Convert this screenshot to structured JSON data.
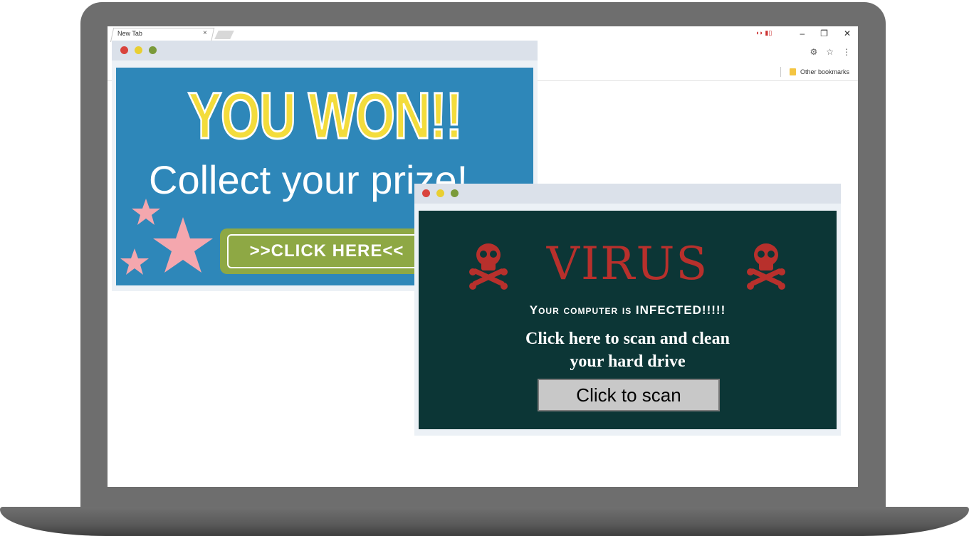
{
  "browser": {
    "tab_label": "New Tab",
    "tab_close": "×",
    "extension_badge": "⁽⁾ ",
    "window_controls": [
      "–",
      "❐",
      "✕"
    ],
    "toolbar_icons": [
      "⚙",
      "☆",
      "⋮"
    ],
    "bookmark_label": "Other bookmarks"
  },
  "prize_popup": {
    "headline": "YOU WON!!",
    "subheadline": "Collect your prize!",
    "button_label": ">>CLICK HERE<<",
    "colors": {
      "background": "#2e87b9",
      "headline": "#f3dc3c",
      "button": "#8ea844",
      "stars": "#f4a7ae"
    }
  },
  "virus_popup": {
    "title": "VIRUS",
    "warning": "Your computer is INFECTED!!!!!",
    "message_line1": "Click here to scan and clean",
    "message_line2": "your hard drive",
    "button_label": "Click to scan",
    "colors": {
      "background": "#0c3636",
      "title": "#b8302c"
    }
  }
}
